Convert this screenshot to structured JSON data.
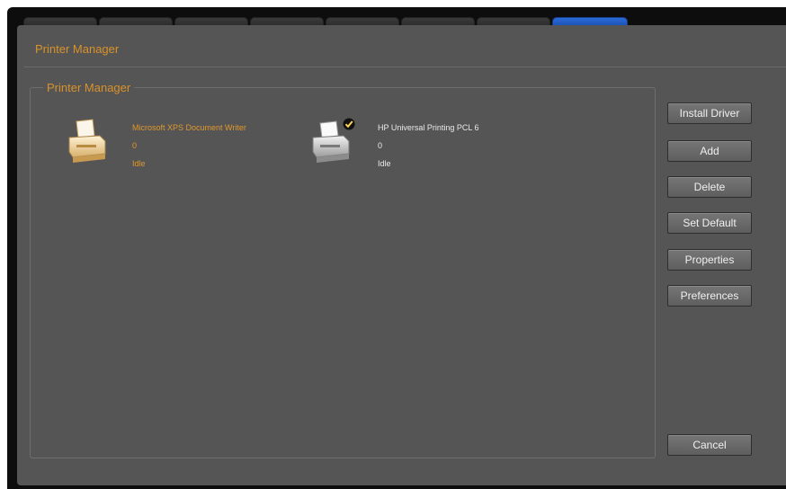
{
  "window": {
    "title": "Printer Manager",
    "tab_count": 8,
    "active_tab_index": 7,
    "accent_color": "#1e58c4"
  },
  "group": {
    "legend": "Printer Manager"
  },
  "printers": [
    {
      "name": "Microsoft XPS Document Writer",
      "jobs": "0",
      "status": "Idle",
      "icon": "printer-icon",
      "is_default": false,
      "text_color": "#e0972c"
    },
    {
      "name": "HP Universal Printing PCL 6",
      "jobs": "0",
      "status": "Idle",
      "icon": "printer-icon",
      "is_default": true,
      "text_color": "#eaeaea"
    }
  ],
  "buttons": {
    "install_driver": "Install Driver",
    "add": "Add",
    "delete": "Delete",
    "set_default": "Set Default",
    "properties": "Properties",
    "preferences": "Preferences",
    "cancel": "Cancel"
  },
  "colors": {
    "title_orange": "#d9922a",
    "panel_bg": "#555555"
  }
}
